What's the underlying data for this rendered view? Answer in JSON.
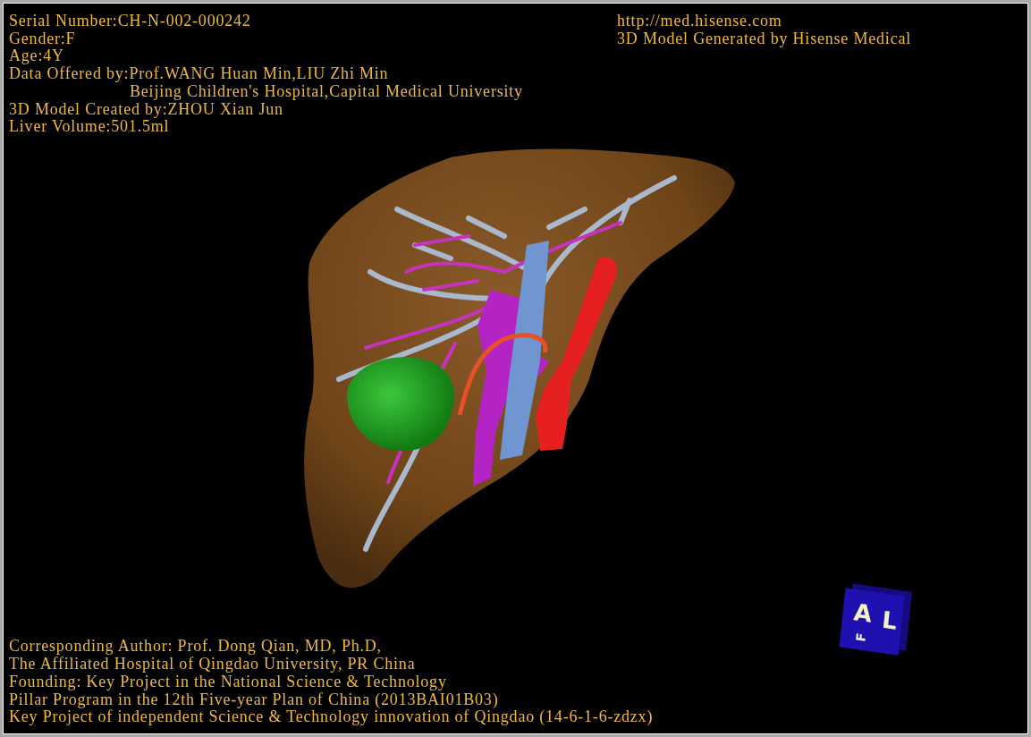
{
  "patient_info": [
    {
      "text": "Serial Number:CH-N-002-000242",
      "indent": false
    },
    {
      "text": "Gender:F",
      "indent": false
    },
    {
      "text": "Age:4Y",
      "indent": false
    },
    {
      "text": "Data Offered by:Prof.WANG Huan Min,LIU Zhi Min",
      "indent": false
    },
    {
      "text": "Beijing Children's Hospital,Capital Medical University",
      "indent": true
    },
    {
      "text": "3D Model Created by:ZHOU Xian Jun",
      "indent": false
    },
    {
      "text": "Liver Volume:501.5ml",
      "indent": false
    }
  ],
  "generator_info": [
    "http://med.hisense.com",
    "3D Model Generated by Hisense Medical"
  ],
  "credits": [
    "Corresponding Author: Prof. Dong Qian, MD, Ph.D,",
    "The Affiliated Hospital of Qingdao University, PR China",
    "Founding: Key Project in the National Science & Technology",
    "Pillar Program in the 12th Five-year Plan of China (2013BAI01B03)",
    "Key Project of independent Science & Technology innovation of Qingdao (14-6-1-6-zdzx)"
  ],
  "orientation_cube": {
    "faces": [
      "A",
      "L",
      "F"
    ]
  }
}
